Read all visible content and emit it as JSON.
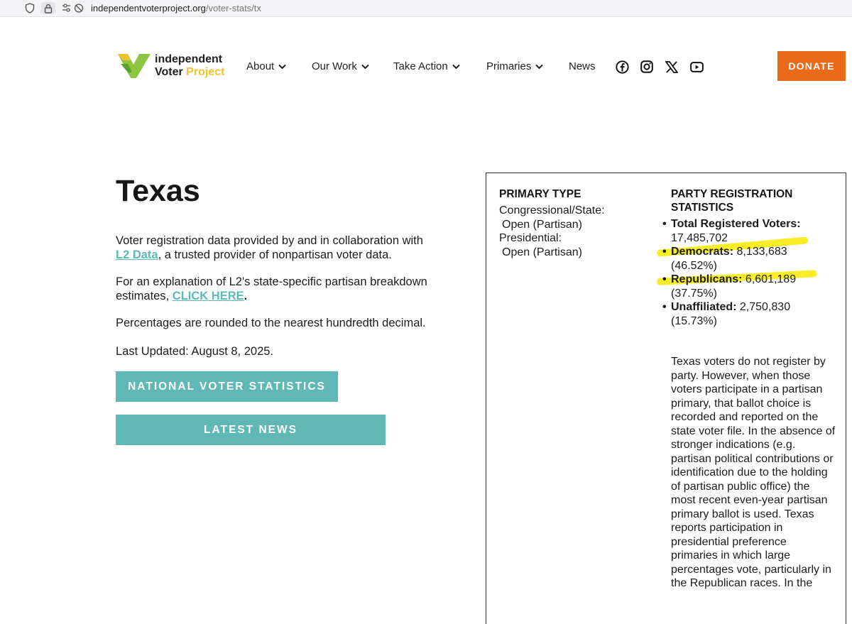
{
  "browser": {
    "url_host": "independentvoterproject.org",
    "url_path": "/voter-stats/tx",
    "icons": [
      "shield-icon",
      "lock-icon",
      "permissions-icon",
      "tracking-off-icon"
    ]
  },
  "header": {
    "logo_line1": "independent",
    "logo_line2_a": "Voter",
    "logo_line2_b": "Project",
    "nav": [
      {
        "label": "About",
        "has_dropdown": true
      },
      {
        "label": "Our Work",
        "has_dropdown": true
      },
      {
        "label": "Take Action",
        "has_dropdown": true
      },
      {
        "label": "Primaries",
        "has_dropdown": true
      },
      {
        "label": "News",
        "has_dropdown": false
      }
    ],
    "social_icons": [
      "facebook-icon",
      "instagram-icon",
      "x-icon",
      "youtube-icon"
    ],
    "donate_label": "DONATE"
  },
  "main": {
    "title": "Texas",
    "p1_a": "Voter registration data provided by and in collaboration with",
    "p1_link": "L2 Data",
    "p1_b": ", a trusted provider of nonpartisan voter data.",
    "p2_a": "For an explanation of L2's state-specific partisan breakdown estimates,",
    "p2_link": "CLICK HERE",
    "p2_b": ".",
    "p3": "Percentages are rounded to the nearest hundredth decimal.",
    "p4": "Last Updated: August 8, 2025.",
    "btn_national": "NATIONAL VOTER STATISTICS",
    "btn_news": "LATEST NEWS"
  },
  "stats_box": {
    "primary_type_heading": "PRIMARY TYPE",
    "primary_lines": [
      "Congressional/State:",
      "Open (Partisan)",
      "Presidential:",
      "Open (Partisan)"
    ],
    "party_heading_1": "PARTY REGISTRATION",
    "party_heading_2": "STATISTICS",
    "stats": [
      {
        "label": "Total Registered Voters:",
        "value": "17,485,702",
        "pct": ""
      },
      {
        "label": "Democrats:",
        "value": "8,133,683",
        "pct": "(46.52%)"
      },
      {
        "label": "Republicans:",
        "value": "6,601,189",
        "pct": "(37.75%)"
      },
      {
        "label": "Unaffiliated:",
        "value": "2,750,830",
        "pct": "(15.73%)"
      }
    ],
    "explanation": "Texas voters do not register by party. However, when those voters participate in a partisan primary, that ballot choice is recorded and reported on the state voter file. In the absence of stronger indications (e.g. partisan political contributions or identification due to the holding of partisan public office) the most recent even-year partisan primary ballot is used. Texas reports participation in presidential preference primaries in which large percentages vote, particularly in the Republican races. In the",
    "highlight_color": "#f7ea00"
  },
  "colors": {
    "accent_teal": "#5fb8b6",
    "donate_orange": "#ea6a19",
    "logo_green": "#8cc63f",
    "logo_yellow": "#f2c12e"
  }
}
